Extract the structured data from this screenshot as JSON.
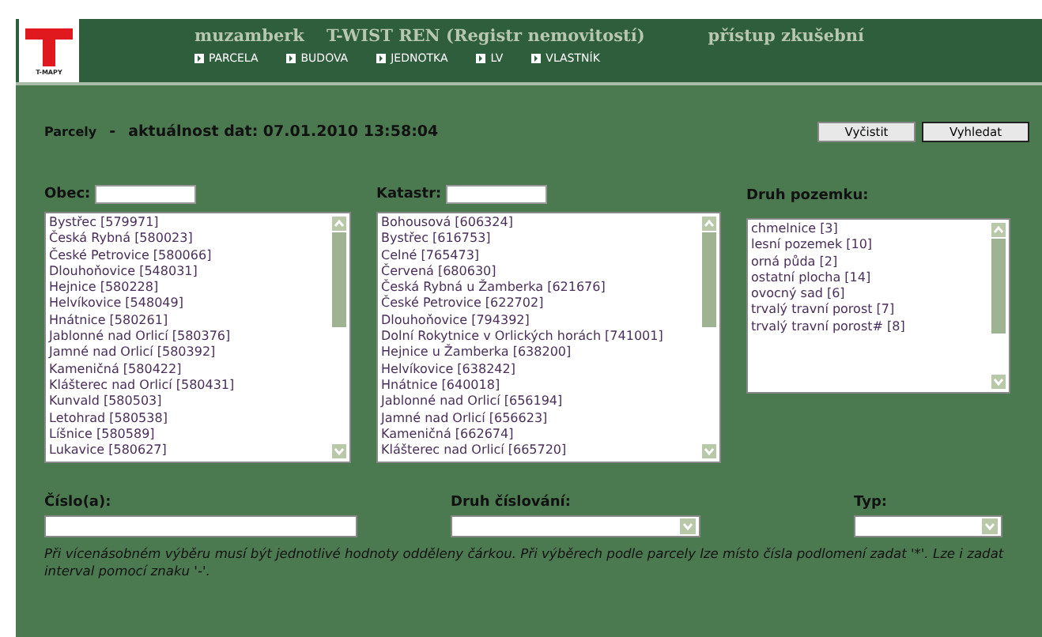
{
  "header": {
    "site": "muzamberk",
    "app_title": "T-WIST REN (Registr nemovitostí)",
    "access": "přístup zkušební",
    "logo_caption": "T-MAPY",
    "nav": [
      {
        "label": "PARCELA"
      },
      {
        "label": "BUDOVA"
      },
      {
        "label": "JEDNOTKA"
      },
      {
        "label": "LV"
      },
      {
        "label": "VLASTNÍK"
      }
    ]
  },
  "page": {
    "title": "Parcely",
    "separator": "-",
    "freshness": "aktuálnost dat: 07.01.2010 13:58:04",
    "buttons": [
      "Vyčistit",
      "Vyhledat"
    ]
  },
  "filters": [
    {
      "label": "Obec:",
      "has_input": true,
      "items": [
        "Bystřec [579971]",
        "Česká Rybná [580023]",
        "České Petrovice [580066]",
        "Dlouhoňovice [548031]",
        "Hejnice [580228]",
        "Helvíkovice [548049]",
        "Hnátnice [580261]",
        "Jablonné nad Orlicí [580376]",
        "Jamné nad Orlicí [580392]",
        "Kameničná [580422]",
        "Klášterec nad Orlicí [580431]",
        "Kunvald [580503]",
        "Letohrad [580538]",
        "Líšnice [580589]",
        "Lukavice [580627]"
      ]
    },
    {
      "label": "Katastr:",
      "has_input": true,
      "items": [
        "Bohousová [606324]",
        "Bystřec [616753]",
        "Celné [765473]",
        "Červená [680630]",
        "Česká Rybná u Žamberka [621676]",
        "České Petrovice [622702]",
        "Dlouhoňovice [794392]",
        "Dolní Rokytnice v Orlických horách [741001]",
        "Hejnice u Žamberka [638200]",
        "Helvíkovice [638242]",
        "Hnátnice [640018]",
        "Jablonné nad Orlicí [656194]",
        "Jamné nad Orlicí [656623]",
        "Kameničná [662674]",
        "Klášterec nad Orlicí [665720]"
      ]
    },
    {
      "label": "Druh pozemku:",
      "has_input": false,
      "items": [
        "chmelnice [3]",
        "lesní pozemek [10]",
        "orná půda [2]",
        "ostatní plocha [14]",
        "ovocný sad [6]",
        "trvalý travní porost [7]",
        "trvalý travní porost# [8]"
      ]
    }
  ],
  "fields": [
    {
      "label": "Číslo(a):",
      "kind": "text"
    },
    {
      "label": "Druh číslování:",
      "kind": "select"
    },
    {
      "label": "Typ:",
      "kind": "select"
    }
  ],
  "note": "Při vícenásobném výběru musí být jednotlivé hodnoty odděleny čárkou. Při výběrech podle parcely lze místo čísla podlomení zadat '*'. Lze i zadat interval pomocí znaku '-'."
}
